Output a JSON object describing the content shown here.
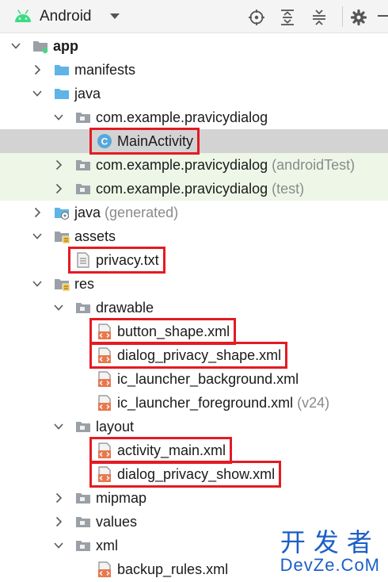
{
  "toolbar": {
    "view_mode": "Android",
    "icons": [
      "android-icon",
      "dropdown-icon",
      "locate-icon",
      "expand-all-icon",
      "collapse-all-icon",
      "gear-icon",
      "hide-icon"
    ]
  },
  "tree": [
    {
      "id": "app",
      "label": "app",
      "indent": 0,
      "arrow": "down",
      "icon": "module",
      "bold": true
    },
    {
      "id": "manifests",
      "label": "manifests",
      "indent": 1,
      "arrow": "right",
      "icon": "folder-blue"
    },
    {
      "id": "java",
      "label": "java",
      "indent": 1,
      "arrow": "down",
      "icon": "folder-blue"
    },
    {
      "id": "pkg-main",
      "label": "com.example.pravicydialog",
      "indent": 2,
      "arrow": "down",
      "icon": "package"
    },
    {
      "id": "mainactivity",
      "label": "MainActivity",
      "indent": 3,
      "arrow": "none",
      "icon": "class",
      "selected": true,
      "highlight": true
    },
    {
      "id": "pkg-androidtest",
      "label": "com.example.pravicydialog",
      "suffix": "(androidTest)",
      "indent": 2,
      "arrow": "right",
      "icon": "package",
      "test": true
    },
    {
      "id": "pkg-test",
      "label": "com.example.pravicydialog",
      "suffix": "(test)",
      "indent": 2,
      "arrow": "right",
      "icon": "package",
      "test": true
    },
    {
      "id": "java-generated",
      "label": "java",
      "suffix": "(generated)",
      "indent": 1,
      "arrow": "right",
      "icon": "folder-gen"
    },
    {
      "id": "assets",
      "label": "assets",
      "indent": 1,
      "arrow": "down",
      "icon": "folder-res"
    },
    {
      "id": "privacy-txt",
      "label": "privacy.txt",
      "indent": 2,
      "arrow": "none",
      "icon": "text-file",
      "highlight": true
    },
    {
      "id": "res",
      "label": "res",
      "indent": 1,
      "arrow": "down",
      "icon": "folder-res"
    },
    {
      "id": "drawable",
      "label": "drawable",
      "indent": 2,
      "arrow": "down",
      "icon": "package"
    },
    {
      "id": "button-shape",
      "label": "button_shape.xml",
      "indent": 3,
      "arrow": "none",
      "icon": "xml-file",
      "highlight": true
    },
    {
      "id": "dialog-privacy-shape",
      "label": "dialog_privacy_shape.xml",
      "indent": 3,
      "arrow": "none",
      "icon": "xml-file",
      "highlight": true
    },
    {
      "id": "ic-launcher-bg",
      "label": "ic_launcher_background.xml",
      "indent": 3,
      "arrow": "none",
      "icon": "xml-file"
    },
    {
      "id": "ic-launcher-fg",
      "label": "ic_launcher_foreground.xml",
      "suffix": "(v24)",
      "indent": 3,
      "arrow": "none",
      "icon": "xml-file"
    },
    {
      "id": "layout",
      "label": "layout",
      "indent": 2,
      "arrow": "down",
      "icon": "package"
    },
    {
      "id": "activity-main",
      "label": "activity_main.xml",
      "indent": 3,
      "arrow": "none",
      "icon": "xml-file",
      "highlight": true
    },
    {
      "id": "dialog-privacy-show",
      "label": "dialog_privacy_show.xml",
      "indent": 3,
      "arrow": "none",
      "icon": "xml-file",
      "highlight": true
    },
    {
      "id": "mipmap",
      "label": "mipmap",
      "indent": 2,
      "arrow": "right",
      "icon": "package"
    },
    {
      "id": "values",
      "label": "values",
      "indent": 2,
      "arrow": "right",
      "icon": "package"
    },
    {
      "id": "xml",
      "label": "xml",
      "indent": 2,
      "arrow": "down",
      "icon": "package"
    },
    {
      "id": "backup-rules",
      "label": "backup_rules.xml",
      "indent": 3,
      "arrow": "none",
      "icon": "xml-file"
    }
  ],
  "watermark": {
    "cn": "开发者",
    "en": "DevZe.CoM"
  },
  "colors": {
    "highlight": "#e31b23",
    "selected": "#d3d3d3",
    "test_row": "#edf6e7",
    "folder_blue": "#5fb4e6",
    "folder_gray": "#9aa0a6",
    "watermark": "#1b5fc7",
    "suffix": "#8a8a8a"
  }
}
